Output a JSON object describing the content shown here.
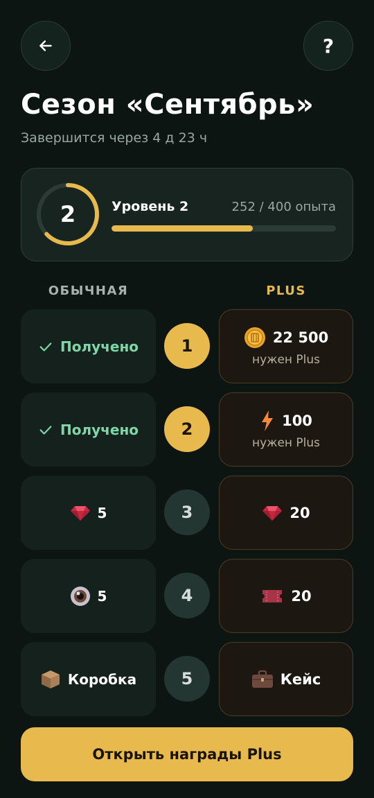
{
  "header": {
    "back_icon": "arrow-left-icon",
    "help_label": "?"
  },
  "season": {
    "title": "Сезон «Сентябрь»",
    "subtitle": "Завершится через 4 д 23 ч"
  },
  "level": {
    "number": "2",
    "label": "Уровень 2",
    "xp_text": "252 / 400 опыта",
    "xp_current": 252,
    "xp_total": 400,
    "ring_progress": 0.63
  },
  "columns": {
    "free": "ОБЫЧНАЯ",
    "plus": "PLUS"
  },
  "rows": [
    {
      "level": "1",
      "state": "done",
      "free": {
        "icon": "check-icon",
        "text": "Получено",
        "received": true
      },
      "plus": {
        "icon": "coin-icon",
        "text": "22 500",
        "sub": "нужен Plus"
      }
    },
    {
      "level": "2",
      "state": "done",
      "free": {
        "icon": "check-icon",
        "text": "Получено",
        "received": true
      },
      "plus": {
        "icon": "lightning-icon",
        "text": "100",
        "sub": "нужен Plus"
      }
    },
    {
      "level": "3",
      "state": "todo",
      "free": {
        "icon": "gem-icon",
        "text": "5",
        "received": false
      },
      "plus": {
        "icon": "gem-icon",
        "text": "20",
        "sub": ""
      }
    },
    {
      "level": "4",
      "state": "todo",
      "free": {
        "icon": "eye-icon",
        "text": "5",
        "received": false
      },
      "plus": {
        "icon": "ticket-icon",
        "text": "20",
        "sub": ""
      }
    },
    {
      "level": "5",
      "state": "todo",
      "free": {
        "icon": "box-icon",
        "text": "Коробка",
        "received": false
      },
      "plus": {
        "icon": "briefcase-icon",
        "text": "Кейс",
        "sub": ""
      }
    }
  ],
  "cta": {
    "label": "Открыть награды Plus"
  },
  "colors": {
    "background": "#0c1512",
    "accent": "#e8b94c",
    "received": "#7fd6a6"
  }
}
